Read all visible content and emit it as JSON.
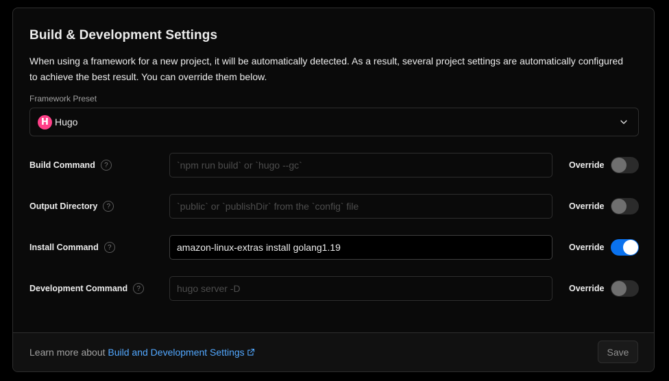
{
  "title": "Build & Development Settings",
  "description": "When using a framework for a new project, it will be automatically detected. As a result, several project settings are automatically configured to achieve the best result. You can override them below.",
  "framework_preset": {
    "label": "Framework Preset",
    "value": "Hugo",
    "logo_letter": "H",
    "logo_color": "#ff4088"
  },
  "override_label": "Override",
  "help_glyph": "?",
  "settings": [
    {
      "label": "Build Command",
      "value": "",
      "placeholder": "`npm run build` or `hugo --gc`",
      "override": false
    },
    {
      "label": "Output Directory",
      "value": "",
      "placeholder": "`public` or `publishDir` from the `config` file",
      "override": false
    },
    {
      "label": "Install Command",
      "value": "amazon-linux-extras install golang1.19",
      "placeholder": "",
      "override": true
    },
    {
      "label": "Development Command",
      "value": "",
      "placeholder": "hugo server -D",
      "override": false
    }
  ],
  "footer": {
    "text": "Learn more about ",
    "link_text": "Build and Development Settings",
    "save_label": "Save"
  },
  "colors": {
    "accent": "#0a72ef",
    "link": "#52a8ff",
    "background": "#0a0a0a",
    "border": "#2e2e2e"
  }
}
